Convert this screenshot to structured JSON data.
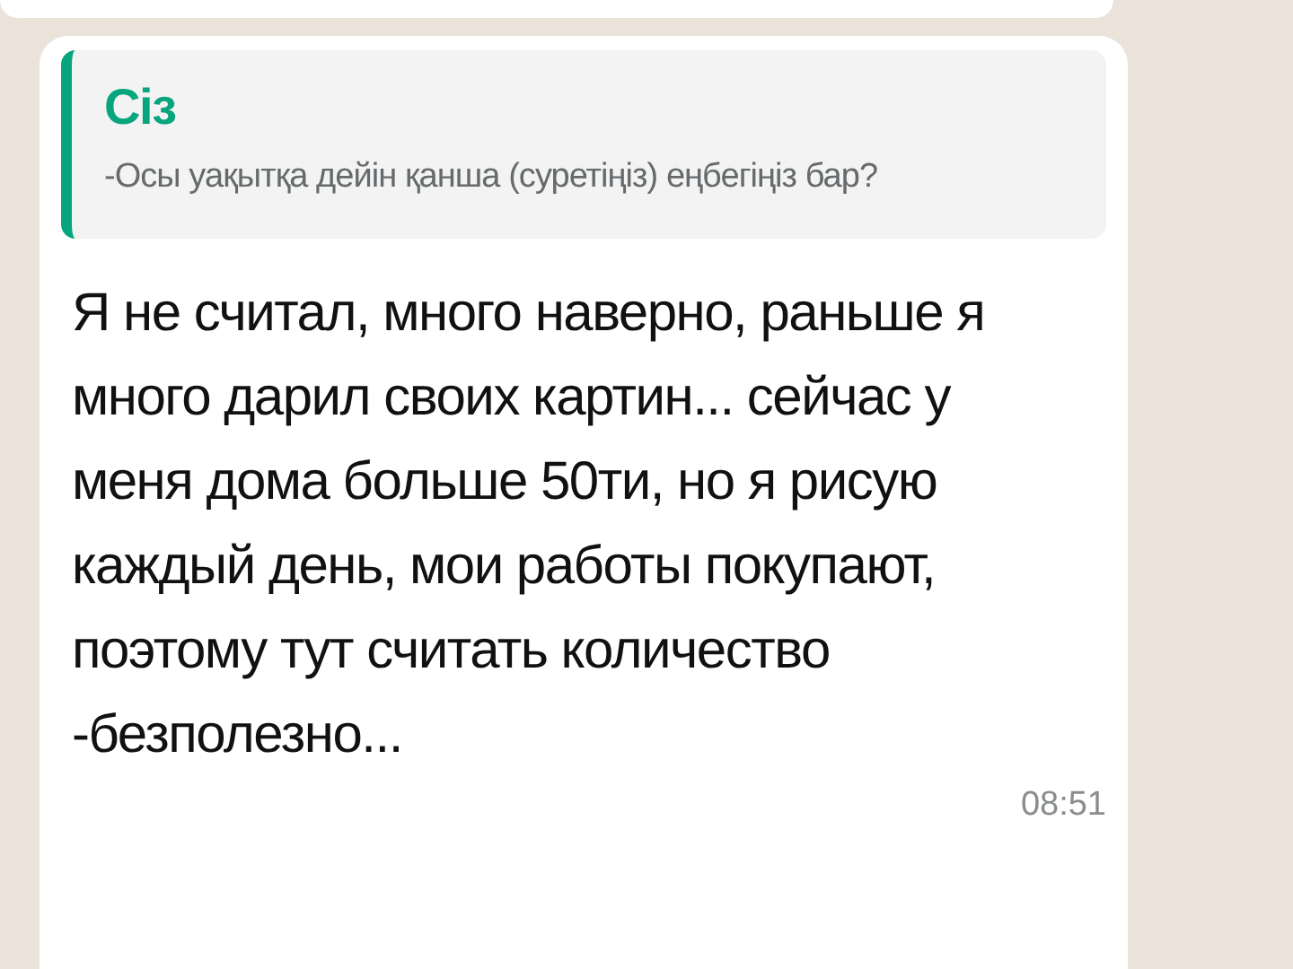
{
  "message": {
    "quote": {
      "author": "Сіз",
      "text": "-Осы уақытқа дейін қанша (суретіңіз) еңбегіңіз бар?"
    },
    "text": "Я не считал, много наверно, раньше я много дарил своих картин... сейчас у меня дома больше 50ти, но я рисую каждый день, мои работы покупают, поэтому тут считать количество -безполезно...",
    "time": "08:51"
  }
}
